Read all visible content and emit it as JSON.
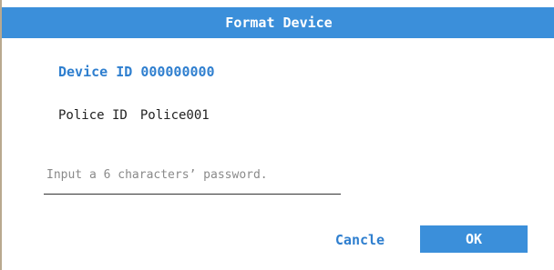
{
  "dialog": {
    "title": "Format Device",
    "device_id_label": "Device ID",
    "device_id_value": "000000000",
    "police_id_label": "Police ID",
    "police_id_value": "Police001",
    "password": {
      "value": "",
      "placeholder": "Input a 6 characters’ password."
    },
    "cancel_label": "Cancle",
    "ok_label": "OK"
  },
  "colors": {
    "accent": "#3b8fda",
    "accent_text": "#2f7fcf",
    "title_text": "#ffffff",
    "body_text": "#222222",
    "placeholder_text": "#8a8a8a",
    "left_border": "#b9a98f"
  }
}
